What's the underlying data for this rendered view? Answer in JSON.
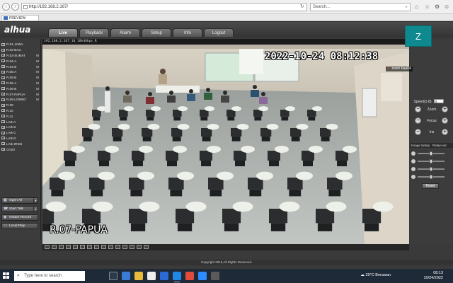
{
  "browser": {
    "url": "http://192.168.2.167/",
    "search_placeholder": "Search...",
    "tab_title": "PREVIEW"
  },
  "app": {
    "logo": "alhua",
    "nav": [
      "Live",
      "Playback",
      "Alarm",
      "Setup",
      "Info",
      "Logout"
    ],
    "active_nav": "Live",
    "footer": "Copyright 2015,All Rights Reserved."
  },
  "channels": [
    {
      "label": "R.01-JAWA",
      "flag": ""
    },
    {
      "label": "R.02-BALI",
      "flag": ""
    },
    {
      "label": "R.03-SUMAT",
      "flag": "M"
    },
    {
      "label": "R.04-A",
      "flag": "M"
    },
    {
      "label": "R.04-B",
      "flag": "M"
    },
    {
      "label": "R.05-A",
      "flag": "M"
    },
    {
      "label": "R.05-B",
      "flag": "M"
    },
    {
      "label": "R.06-A",
      "flag": "M"
    },
    {
      "label": "R.06-B",
      "flag": "M"
    },
    {
      "label": "R.07-PAPUA",
      "flag": "M"
    },
    {
      "label": "R.08-LOMBO",
      "flag": "M"
    },
    {
      "label": "R.09",
      "flag": ""
    },
    {
      "label": "R.10",
      "flag": ""
    },
    {
      "label": "R.11",
      "flag": ""
    },
    {
      "label": "LAB-A",
      "flag": ""
    },
    {
      "label": "LAB-B",
      "flag": ""
    },
    {
      "label": "LAB-C",
      "flag": ""
    },
    {
      "label": "LAB-D",
      "flag": ""
    },
    {
      "label": "LAB-JRSN",
      "flag": ""
    },
    {
      "label": "CH20",
      "flag": ""
    }
  ],
  "sidebar_buttons": {
    "open_all": "Open All",
    "start_talk": "Start Talk",
    "instant_record": "Instant Record",
    "local_play": "Local Play"
  },
  "video": {
    "title_bar": "192.168.2.167_18_10h4Ohps_R",
    "osd_time": "2022-10-24 08:12:38",
    "osd_name": "R.07-PAPUA"
  },
  "overlay": {
    "zoom_initial": "Z",
    "zoom_user": "zoom baa04"
  },
  "ptz": {
    "speed_label": "Speed(1-8)",
    "speed_value": "5",
    "zoom_label": "Zoom",
    "focus_label": "Focus",
    "iris_label": "Iris",
    "image_setup": "Image Setup",
    "relay_out": "Relay-out",
    "reset": "Reset",
    "sliders": [
      0.5,
      0.5,
      0.5,
      0.5
    ]
  },
  "taskbar": {
    "search_placeholder": "Type here to search",
    "weather_temp": "29°C",
    "weather_text": "Berawan",
    "time": "08:13",
    "date": "10/24/2022"
  },
  "colors": {
    "zoom_tile": "#0e8a8f",
    "taskbar": "#1f2a38",
    "app_bg": "#3a3a3a"
  }
}
